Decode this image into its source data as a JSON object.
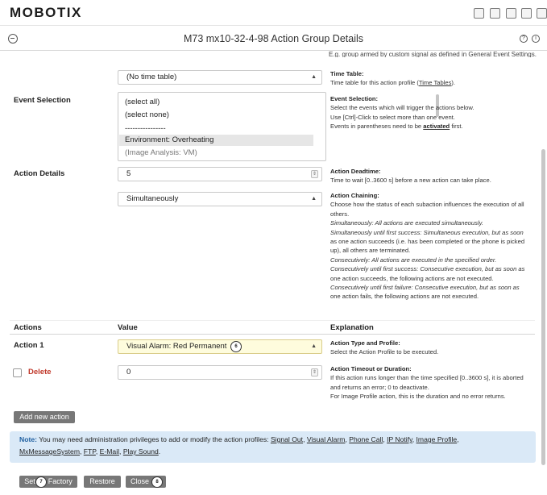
{
  "app": {
    "brand": "MOBOTIX",
    "title": "M73 mx10-32-4-98   Action Group Details"
  },
  "colors": {
    "accent_blue": "#1f5fa0",
    "note_bg": "#dae9f7",
    "button_gray": "#777777",
    "highlight_field": "#fefcdd",
    "delete_red": "#c0392b"
  },
  "top_partial_text": "E.g. group armed by custom signal as defined in General Event Settings.",
  "time_table": {
    "value": "(No time table)",
    "expl_title": "Time Table:",
    "expl_text": "Time table for this action profile (",
    "expl_link": "Time Tables",
    "expl_end": ")."
  },
  "event_selection": {
    "label": "Event Selection",
    "options": [
      "(select all)",
      "(select none)",
      "----------------",
      "Environment: Overheating",
      "(Image Analysis: VM)"
    ],
    "selected_index": 3,
    "expl_title": "Event Selection:",
    "expl_lines": [
      "Select the events which will trigger the actions below.",
      "Use [Ctrl]-Click to select more than one event."
    ],
    "expl_last_pre": "Events in parentheses need to be ",
    "expl_last_link": "activated",
    "expl_last_end": " first."
  },
  "action_details": {
    "label": "Action Details",
    "deadtime_value": "5",
    "deadtime_title": "Action Deadtime:",
    "deadtime_text": "Time to wait [0..3600 s] before a new action can take place.",
    "chaining_value": "Simultaneously",
    "chaining_title": "Action Chaining:",
    "chaining_lines": [
      "Choose how the status of each subaction influences the execution of all",
      "others.",
      "Simultaneously: All actions are executed simultaneously.",
      "Simultaneously until first success: Simultaneous execution, but as soon",
      "as one action succeeds (i.e. has been completed or the phone is picked",
      "up), all others are terminated.",
      "Consecutively: All actions are executed in the specified order.",
      "Consecutively until first success: Consecutive execution, but as soon as",
      "one action succeeds, the following actions are not executed.",
      "Consecutively until first failure: Consecutive execution, but as soon as",
      "one action fails, the following actions are not executed."
    ]
  },
  "actions_table": {
    "col_actions": "Actions",
    "col_value": "Value",
    "col_explanation": "Explanation",
    "action1_label": "Action 1",
    "action1_value": "Visual Alarm: Red Permanent",
    "type_title": "Action Type and Profile:",
    "type_text": "Select the Action Profile to be executed.",
    "delete_label": "Delete",
    "timeout_value": "0",
    "timeout_title": "Action Timeout or Duration:",
    "timeout_lines": [
      "If this action runs longer than the time specified [0..3600 s], it is aborted",
      "and returns an error; 0 to deactivate.",
      "For Image Profile action, this is the duration and no error returns."
    ]
  },
  "add_button": "Add new action",
  "note": {
    "prefix": "Note:",
    "text": " You may need administration privileges to add or modify the action profiles: ",
    "links": [
      "Signal Out",
      "Visual Alarm",
      "Phone Call",
      "IP Notify",
      "Image Profile",
      "MxMessageSystem",
      "FTP",
      "E-Mail",
      "Play Sound"
    ]
  },
  "footer": {
    "set": "Set",
    "factory": "Factory",
    "restore": "Restore",
    "close": "Close"
  },
  "badges": {
    "b6": "6",
    "b7": "7",
    "b8": "8"
  }
}
